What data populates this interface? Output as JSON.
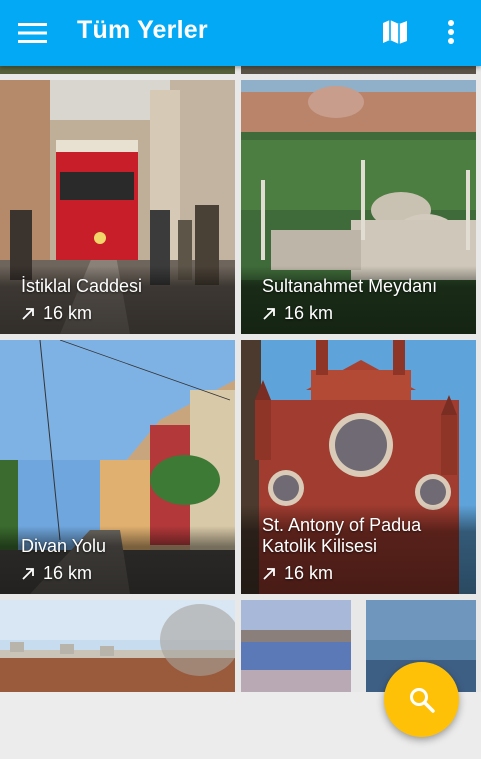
{
  "app_bar": {
    "title": "Tüm Yerler",
    "menu_icon": "menu-icon",
    "map_icon": "map-icon",
    "more_icon": "more-vert-icon",
    "color": "#03a9f4"
  },
  "places": [
    {
      "name": "İstiklal Caddesi",
      "distance": "16 km"
    },
    {
      "name": "Sultanahmet Meydanı",
      "distance": "16 km"
    },
    {
      "name": "Divan Yolu",
      "distance": "16 km"
    },
    {
      "name": "St. Antony of Padua Katolik Kilisesi",
      "distance": "16 km"
    }
  ],
  "distance_icon": "arrow-up-right-icon",
  "fab": {
    "icon": "search-icon",
    "color": "#ffc107"
  }
}
